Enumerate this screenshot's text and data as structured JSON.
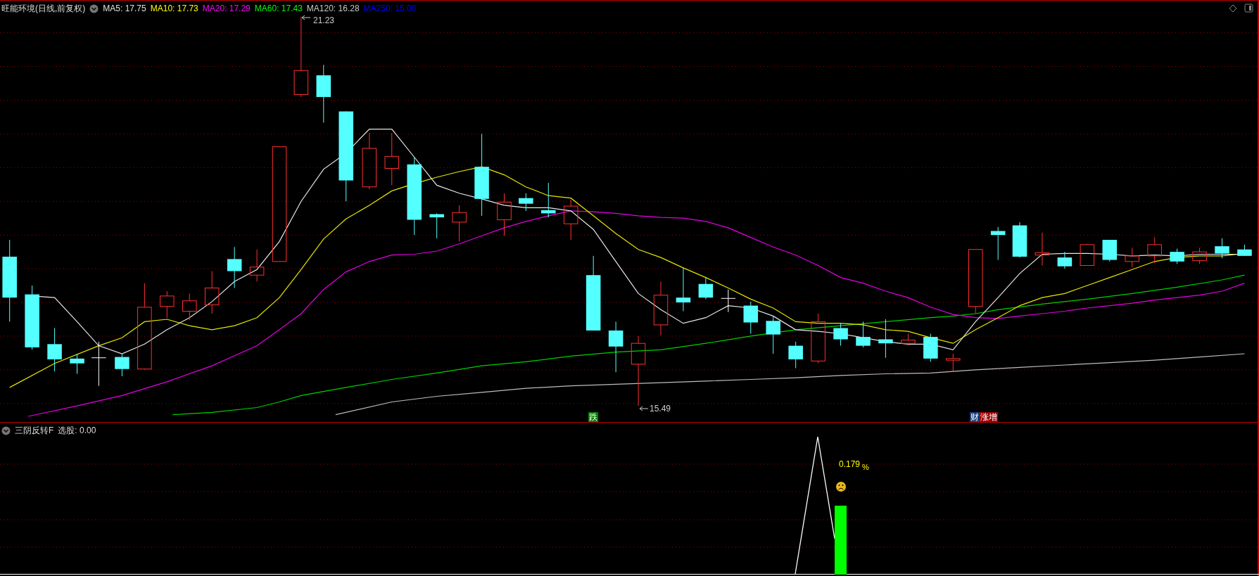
{
  "main_panel": {
    "title": "旺能环境(日线,前复权)",
    "ma_legend": [
      {
        "label": "MA5: 17.75",
        "color": "#e0e0e0"
      },
      {
        "label": "MA10: 17.73",
        "color": "#ffff00"
      },
      {
        "label": "MA20: 17.29",
        "color": "#ff00ff"
      },
      {
        "label": "MA60: 17.43",
        "color": "#00ff00"
      },
      {
        "label": "MA120: 16.28",
        "color": "#c8c8c8"
      },
      {
        "label": "MA250: 15.00",
        "color": "#0000ff"
      }
    ],
    "high_label": "21.23",
    "low_label": "15.49",
    "signals": [
      {
        "text": "跌",
        "color": "#008000"
      },
      {
        "text": "财",
        "color": "#1a3a78"
      },
      {
        "text": "涨增",
        "color": "#9b0000"
      }
    ]
  },
  "indicator_panel": {
    "name": "三阴反转F",
    "reading": "选股: 0.00",
    "value_label": "0.179",
    "unit": "%"
  }
}
